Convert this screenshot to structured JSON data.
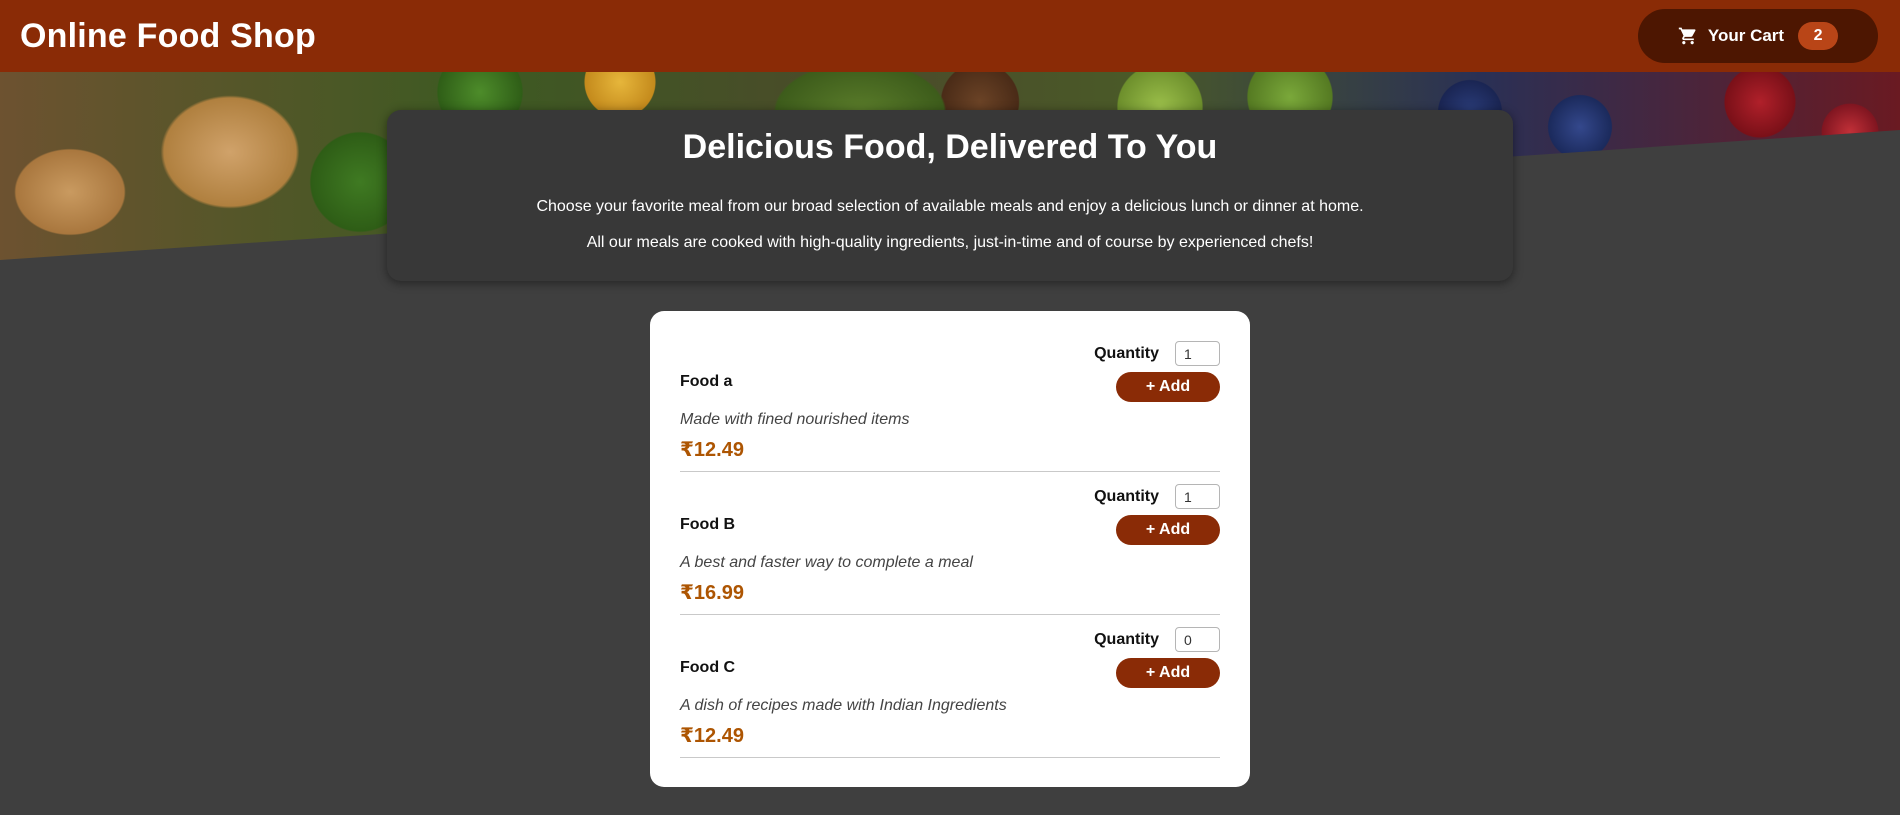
{
  "header": {
    "title": "Online Food Shop",
    "cart_label": "Your Cart",
    "cart_count": "2",
    "cart_icon": "cart-icon"
  },
  "summary": {
    "heading": "Delicious Food, Delivered To You",
    "line1": "Choose your favorite meal from our broad selection of available meals and enjoy a delicious lunch or dinner at home.",
    "line2": "All our meals are cooked with high-quality ingredients, just-in-time and of course by experienced chefs!"
  },
  "meals": [
    {
      "name": "Food a",
      "description": "Made with fined nourished items",
      "price": "₹12.49",
      "quantity_label": "Quantity",
      "quantity": "1",
      "add_label": "+ Add"
    },
    {
      "name": "Food B",
      "description": "A best and faster way to complete a meal",
      "price": "₹16.99",
      "quantity_label": "Quantity",
      "quantity": "1",
      "add_label": "+ Add"
    },
    {
      "name": "Food C",
      "description": "A dish of recipes made with Indian Ingredients",
      "price": "₹12.49",
      "quantity_label": "Quantity",
      "quantity": "0",
      "add_label": "+ Add"
    }
  ],
  "colors": {
    "header_bg": "#8a2b06",
    "cart_button_bg": "#4d1601",
    "badge_bg": "#b94517",
    "page_bg": "#3f3f3f",
    "price": "#ad5502"
  }
}
